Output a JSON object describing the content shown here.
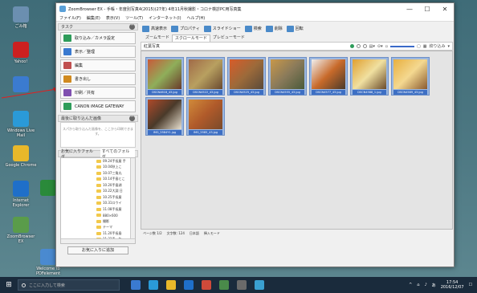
{
  "desktop": {
    "icons": [
      {
        "label": "ごみ箱",
        "color": "#6b8fb0"
      },
      {
        "label": "Yahoo!",
        "color": "#cc2020"
      },
      {
        "label": "",
        "color": "#3b7bd0"
      },
      {
        "label": "Windows Live Mail",
        "color": "#2a9ad8"
      },
      {
        "label": "Google Chrome",
        "color": "#e8b82a"
      },
      {
        "label": "Internet Explorer",
        "color": "#1f6fc9"
      },
      {
        "label": "ZoomBrowser EX",
        "color": "#5a9c4a"
      },
      {
        "label": "",
        "color": "#2a8a3a"
      },
      {
        "label": "Welcome to PDFelement",
        "color": "#4a8ad0"
      }
    ]
  },
  "window": {
    "title": "ZoomBrowser EX - 手帳・年度別写真4(2015)(27年) 4年11月秋撮影・コロナ検診PC用写真集",
    "menus": [
      "ファイル(F)",
      "編集(E)",
      "表示(V)",
      "ツール(T)",
      "インターネット(I)",
      "ヘルプ(H)"
    ],
    "buttons": {
      "minimize": "—",
      "maximize": "☐",
      "close": "✕"
    }
  },
  "left_panel": {
    "task_header": "タスク",
    "tasks": [
      {
        "label": "取り込み／カメラ設定",
        "color": "#2e9c5a"
      },
      {
        "label": "表示／整理",
        "color": "#3a7ad0"
      },
      {
        "label": "編集",
        "color": "#c05050"
      },
      {
        "label": "書き出し",
        "color": "#d08a20"
      },
      {
        "label": "印刷／共有",
        "color": "#8050b0"
      },
      {
        "label": "CANON iMAGE GATEWAY",
        "color": "#2e9c5a"
      }
    ],
    "desc_header": "最後に取り込んだ画像",
    "desc_text": "スパから取り込んだ画像を、ここから印刷できます。",
    "folder_tabs": [
      "お気に入りフォルダ",
      "すべてのフォルダ"
    ],
    "tree_items": [
      "09.24手長屋 手",
      "10.04秋上こ",
      "10.07三角丸",
      "10.14手島とこ",
      "10.20手島湖",
      "10.22大淵 日",
      "10.25手長屋",
      "10.31ロウイ",
      "11.08手長屋",
      "880×600",
      "撮影",
      "テーマ",
      "11.20手長島",
      "11.22手…年"
    ],
    "add_fav": "お気に入りに追加"
  },
  "right_panel": {
    "toolbar": [
      {
        "label": "高速表示",
        "icon": "fast-view-icon"
      },
      {
        "label": "プロパティ",
        "icon": "properties-icon"
      },
      {
        "label": "スライドショー",
        "icon": "slideshow-icon"
      },
      {
        "label": "検索",
        "icon": "search-icon"
      },
      {
        "label": "削除",
        "icon": "delete-icon"
      },
      {
        "label": "回転",
        "icon": "rotate-icon"
      }
    ],
    "view_tabs": [
      "ズームモード",
      "スクロールモード",
      "プレビューモード"
    ],
    "active_tab": 1,
    "path": "紅葉写真",
    "select_label": "絞り込み",
    "thumbnails": [
      {
        "label": "DSCN4618_43.jpg",
        "colors": [
          "#c85a3a",
          "#8fae5a",
          "#6a3a2a"
        ]
      },
      {
        "label": "DSCN4522_43.jpg",
        "colors": [
          "#a06a48",
          "#b8a060",
          "#6a4a30"
        ]
      },
      {
        "label": "DSCN4525_43.jpg",
        "colors": [
          "#d85c2a",
          "#9c6a3a",
          "#5a4a3a"
        ]
      },
      {
        "label": "DSCN4555_43.jpg",
        "colors": [
          "#c8984a",
          "#8a7a5a",
          "#4a5a3a"
        ]
      },
      {
        "label": "DSCN4577_43.jpg",
        "colors": [
          "#f0f0f0",
          "#c86a2a",
          "#4a3a2a"
        ]
      },
      {
        "label": "DSCN4588_1.jpg",
        "colors": [
          "#e0a030",
          "#f0e0a0",
          "#6a4a2a"
        ]
      },
      {
        "label": "DSCN4589_43.jpg",
        "colors": [
          "#e8b040",
          "#f4d890",
          "#8a5a30"
        ]
      },
      {
        "label": "IMG_5584Y1.jpg",
        "colors": [
          "#b04a2a",
          "#4a3a2a",
          "#e8e0d0"
        ]
      },
      {
        "label": "IMG_5585_43.jpg",
        "colors": [
          "#d08a3a",
          "#b05a2a",
          "#7a4a2a"
        ]
      }
    ],
    "status": [
      "ページ数 1/2",
      "文字数: 124",
      "日本語",
      "挿入モード"
    ]
  },
  "taskbar": {
    "search_placeholder": "ここに入力して検索",
    "apps": [
      "#3a7ad0",
      "#2a9ad8",
      "#e8b82a",
      "#1f6fc9",
      "#d04a3a",
      "#4a8a4a",
      "#6a6a6a",
      "#3aa0d0"
    ],
    "time": "17:54",
    "date": "2016/12/07"
  }
}
